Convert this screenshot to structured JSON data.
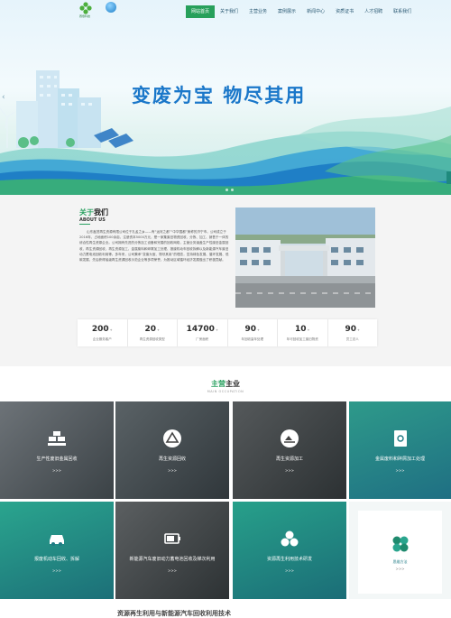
{
  "header": {
    "logo_text": "赛鼎科技",
    "nav": [
      "网站首页",
      "关于我们",
      "主营业务",
      "案例展示",
      "新闻中心",
      "资质证书",
      "人才招聘",
      "联系我们"
    ],
    "active_index": 0
  },
  "hero": {
    "title": "变废为宝  物尽其用",
    "prev_arrow": "‹"
  },
  "about": {
    "title_accent": "关于",
    "title_rest": "我们",
    "subtitle": "ABOUT US",
    "text": "山东鑫茂再生资源有限公司位于孔孟之乡——有“运河之都”“中华国都”美称的济宁市。公司成立于2016年，占地面积100余亩，注册资本5000万元，是一家集废旧物资回收、分拣、加工、销售于一体的综合性再生资源企业。公司拥有先进的分拣加工设备和完善的回收网络，主营业务涵盖生产性废旧金属回收、再生资源回收、再生资源加工、金属废料和碎屑加工处理、报废机动车回收拆解以及新能源汽车废旧动力蓄电池回收利用等。多年来，公司秉承“变废为宝、物尽其用”的理念，坚持绿色发展、循环发展、低碳发展，先后获得省级再生资源回收示范企业等多项荣誉，为推动区域循环经济发展做出了积极贡献。",
    "stats": [
      {
        "num": "200",
        "unit": "+",
        "label": "企业服务客户"
      },
      {
        "num": "20",
        "unit": "+",
        "label": "再生资源回收类型"
      },
      {
        "num": "14700",
        "unit": "+",
        "label": "厂房面积"
      },
      {
        "num": "90",
        "unit": "+",
        "label": "年回收量年处理"
      },
      {
        "num": "10",
        "unit": "+",
        "label": "年可回收加工废旧物资"
      },
      {
        "num": "90",
        "unit": "+",
        "label": "员工总人"
      }
    ]
  },
  "business": {
    "title_accent": "主营",
    "title_rest": "主业",
    "subtitle": "MAIN OCCUPATION",
    "more": ">>>",
    "tiles": [
      {
        "label": "生产性废旧金属回收",
        "icon": "gold-bars-icon"
      },
      {
        "label": "再生资源回收",
        "icon": "recycle-triangle-icon"
      },
      {
        "label": "再生资源加工",
        "icon": "recycle-hand-icon"
      },
      {
        "label": "金属废料和碎屑加工处理",
        "icon": "document-gear-icon"
      },
      {
        "label": "报废机动车回收、拆解",
        "icon": "car-icon"
      },
      {
        "label": "新能源汽车废旧动力蓄电池回收及梯次利用",
        "icon": "battery-icon"
      },
      {
        "label": "资源再生利用技术研发",
        "icon": "eco-cluster-icon"
      },
      {
        "label": "思维方法",
        "icon": "leaf-cluster-icon"
      }
    ]
  },
  "footer_heading": "资源再生利用与新能源汽车回收利用技术"
}
